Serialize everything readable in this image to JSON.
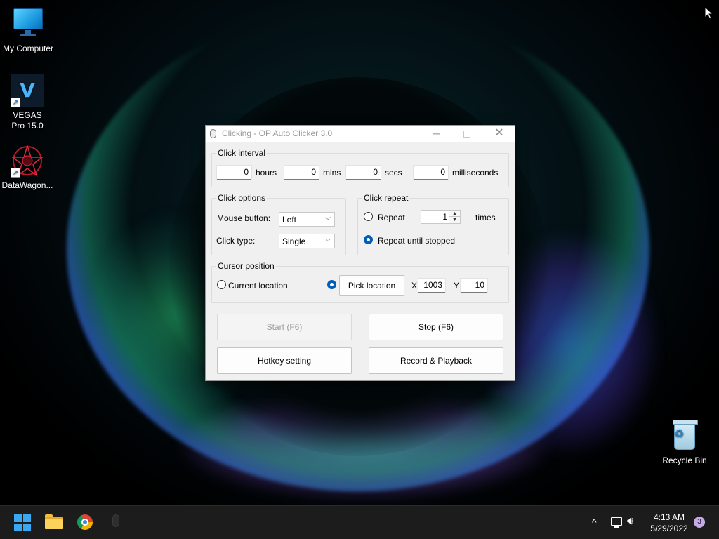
{
  "desktop": {
    "icons": [
      {
        "label": "My Computer"
      },
      {
        "label": "VEGAS Pro 15.0",
        "glyph": "V"
      },
      {
        "label": "DataWagon..."
      },
      {
        "label": "Recycle Bin"
      }
    ]
  },
  "window": {
    "title": "Clicking - OP Auto Clicker 3.0",
    "controls": {
      "minimize": "─",
      "close": "✕"
    },
    "click_interval": {
      "legend": "Click interval",
      "hours_value": "0",
      "hours_label": "hours",
      "mins_value": "0",
      "mins_label": "mins",
      "secs_value": "0",
      "secs_label": "secs",
      "ms_value": "0",
      "ms_label": "milliseconds"
    },
    "click_options": {
      "legend": "Click options",
      "mouse_button_label": "Mouse button:",
      "mouse_button_value": "Left",
      "click_type_label": "Click type:",
      "click_type_value": "Single"
    },
    "click_repeat": {
      "legend": "Click repeat",
      "repeat_label": "Repeat",
      "repeat_value": "1",
      "times_label": "times",
      "until_stopped_label": "Repeat until stopped",
      "selected": "until_stopped"
    },
    "cursor_position": {
      "legend": "Cursor position",
      "current_location_label": "Current location",
      "pick_location_label": "Pick location",
      "x_label": "X",
      "x_value": "1003",
      "y_label": "Y",
      "y_value": "10",
      "selected": "pick_location"
    },
    "buttons": {
      "start": "Start (F6)",
      "stop": "Stop (F6)",
      "hotkey": "Hotkey setting",
      "record": "Record & Playback"
    }
  },
  "taskbar": {
    "apps": [
      "start-menu",
      "file-explorer",
      "google-chrome",
      "op-auto-clicker"
    ],
    "tray_chevron": "^",
    "time": "4:13 AM",
    "date": "5/29/2022",
    "notification_count": "3"
  },
  "colors": {
    "accent": "#005fb8",
    "taskbar": "#1c1c1c",
    "window_bg": "#f0f0f0"
  }
}
